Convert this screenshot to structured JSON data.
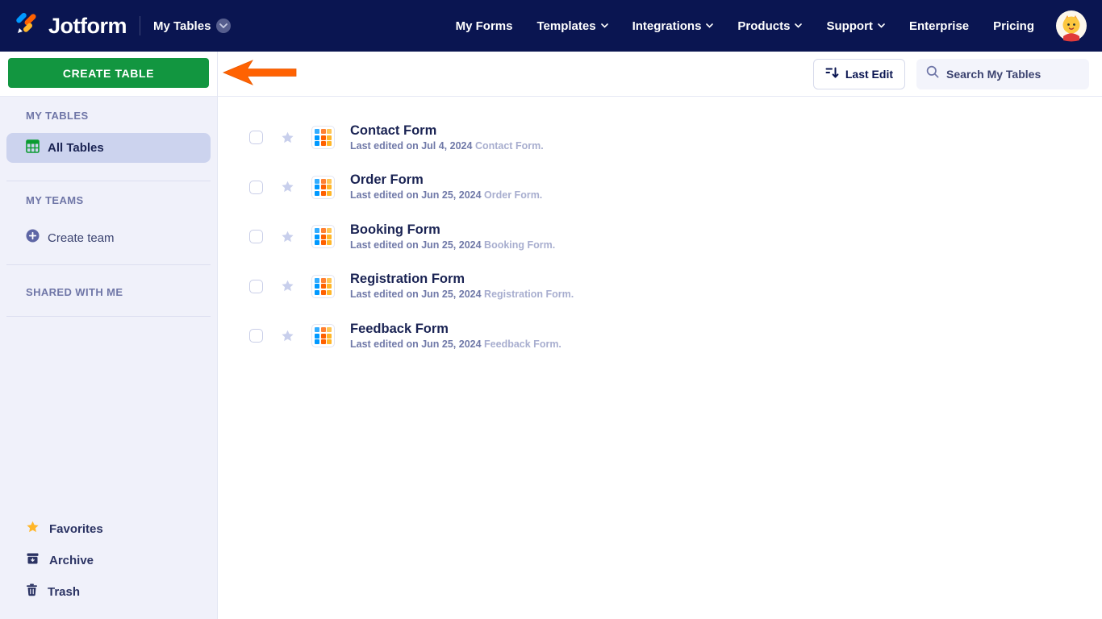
{
  "navbar": {
    "brand": "Jotform",
    "product_switcher": "My Tables",
    "links": [
      {
        "label": "My Forms"
      },
      {
        "label": "Templates"
      },
      {
        "label": "Integrations"
      },
      {
        "label": "Products"
      },
      {
        "label": "Support"
      },
      {
        "label": "Enterprise"
      },
      {
        "label": "Pricing"
      }
    ]
  },
  "sidebar": {
    "create_button": "CREATE TABLE",
    "my_tables_header": "MY TABLES",
    "all_tables_label": "All Tables",
    "my_teams_header": "MY TEAMS",
    "create_team_label": "Create team",
    "shared_header": "SHARED WITH ME",
    "footer_items": [
      {
        "label": "Favorites",
        "icon": "star-icon"
      },
      {
        "label": "Archive",
        "icon": "archive-icon"
      },
      {
        "label": "Trash",
        "icon": "trash-icon"
      }
    ]
  },
  "toolbar": {
    "sort_button": "Last Edit",
    "search_placeholder": "Search My Tables"
  },
  "tables": [
    {
      "title": "Contact Form",
      "last_edited": "Last edited on Jul 4, 2024",
      "suffix": "Contact Form."
    },
    {
      "title": "Order Form",
      "last_edited": "Last edited on Jun 25, 2024",
      "suffix": "Order Form."
    },
    {
      "title": "Booking Form",
      "last_edited": "Last edited on Jun 25, 2024",
      "suffix": "Booking Form."
    },
    {
      "title": "Registration Form",
      "last_edited": "Last edited on Jun 25, 2024",
      "suffix": "Registration Form."
    },
    {
      "title": "Feedback Form",
      "last_edited": "Last edited on Jun 25, 2024",
      "suffix": "Feedback Form."
    }
  ],
  "colors": {
    "navbar_navy": "#0a1551",
    "accent_green": "#129640",
    "arrow_orange": "#ff6100",
    "icon_blue": "#0099ff",
    "icon_orange": "#ff6100",
    "icon_yellow": "#ffb629",
    "sidebar_bg": "#f0f1fa",
    "selected_bg": "#ccd3ee"
  }
}
